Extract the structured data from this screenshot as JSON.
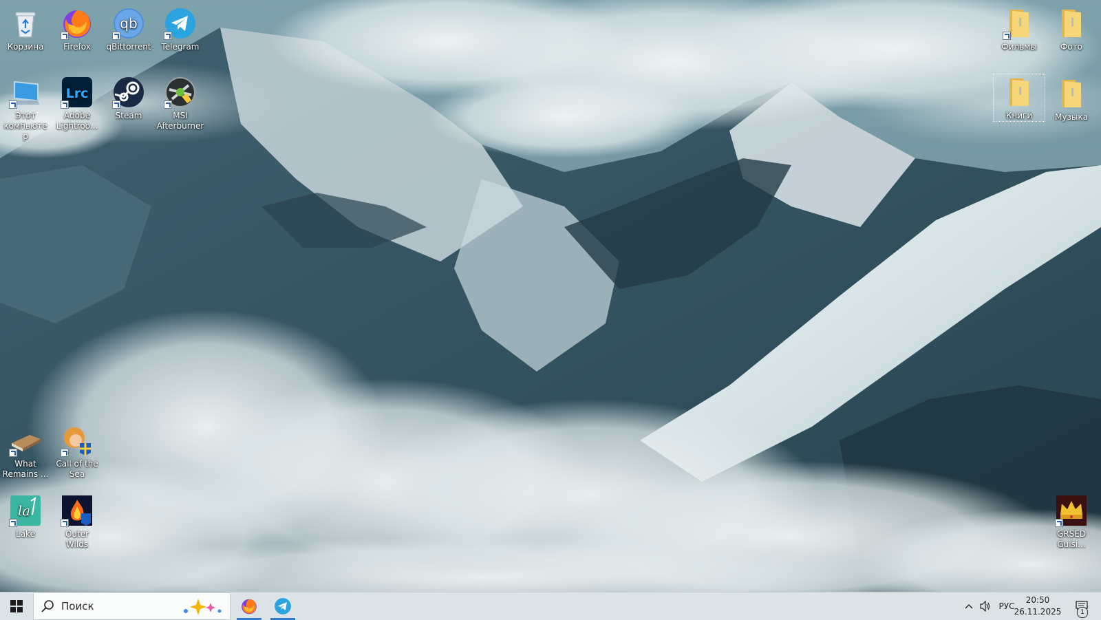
{
  "desktop": {
    "icons": [
      {
        "label": "Корзина"
      },
      {
        "label": "Firefox"
      },
      {
        "label": "qBittorrent"
      },
      {
        "label": "Telegram"
      },
      {
        "label": "Этот компьютер"
      },
      {
        "label": "Adobe Lightroo..."
      },
      {
        "label": "Steam"
      },
      {
        "label": "MSI Afterburner"
      },
      {
        "label": "What Remains ..."
      },
      {
        "label": "Call of the Sea"
      },
      {
        "label": "Lake"
      },
      {
        "label": "Outer Wilds"
      },
      {
        "label": "Фильмы"
      },
      {
        "label": "Фото"
      },
      {
        "label": "Книги"
      },
      {
        "label": "Музыка"
      },
      {
        "label": "GRSED Guisi..."
      }
    ]
  },
  "taskbar": {
    "search_placeholder": "Поиск",
    "pinned_apps": [
      "Firefox",
      "Telegram"
    ],
    "language": "РУС",
    "time": "20:50",
    "date": "26.11.2025",
    "notification_count": "1"
  },
  "colors": {
    "taskbar_bg": "#dbe3e6",
    "active_indicator": "#3578c6",
    "folder_yellow": "#f2cf63"
  }
}
